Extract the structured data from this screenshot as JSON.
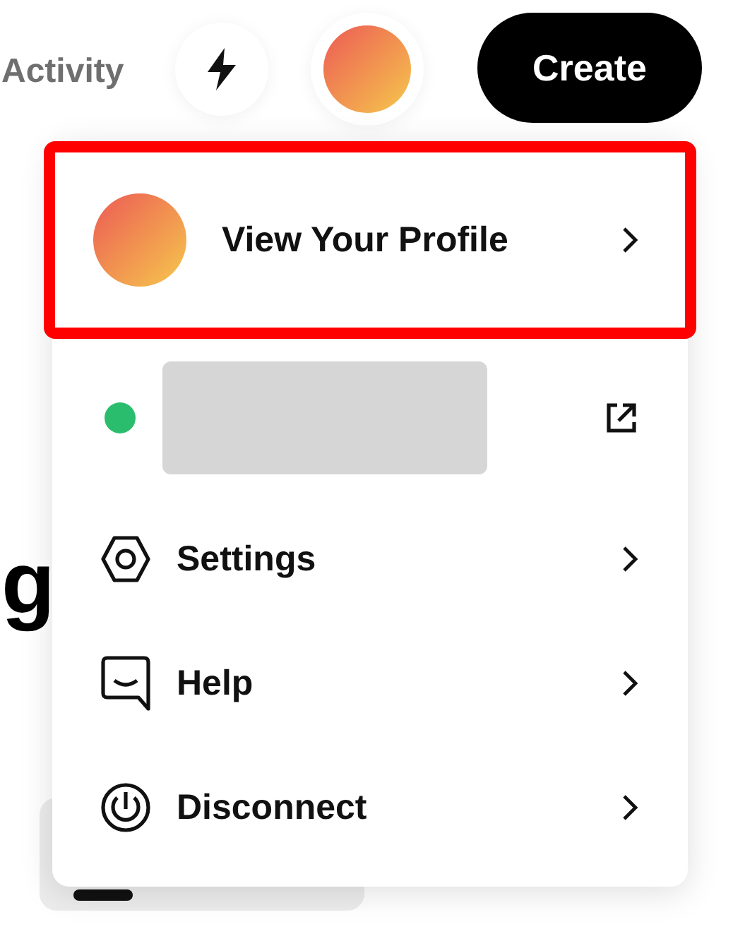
{
  "top_bar": {
    "activity_link": "Activity",
    "create_button": "Create"
  },
  "page": {
    "heading_fragment": "g"
  },
  "menu": {
    "items": [
      {
        "kind": "profile",
        "label": "View Your Profile",
        "highlighted": true
      },
      {
        "kind": "wallet",
        "color": "#2bbd6e",
        "highlighted": false
      },
      {
        "kind": "settings",
        "label": "Settings",
        "highlighted": false
      },
      {
        "kind": "help",
        "label": "Help",
        "highlighted": false
      },
      {
        "kind": "disconnect",
        "label": "Disconnect",
        "highlighted": false
      }
    ]
  }
}
